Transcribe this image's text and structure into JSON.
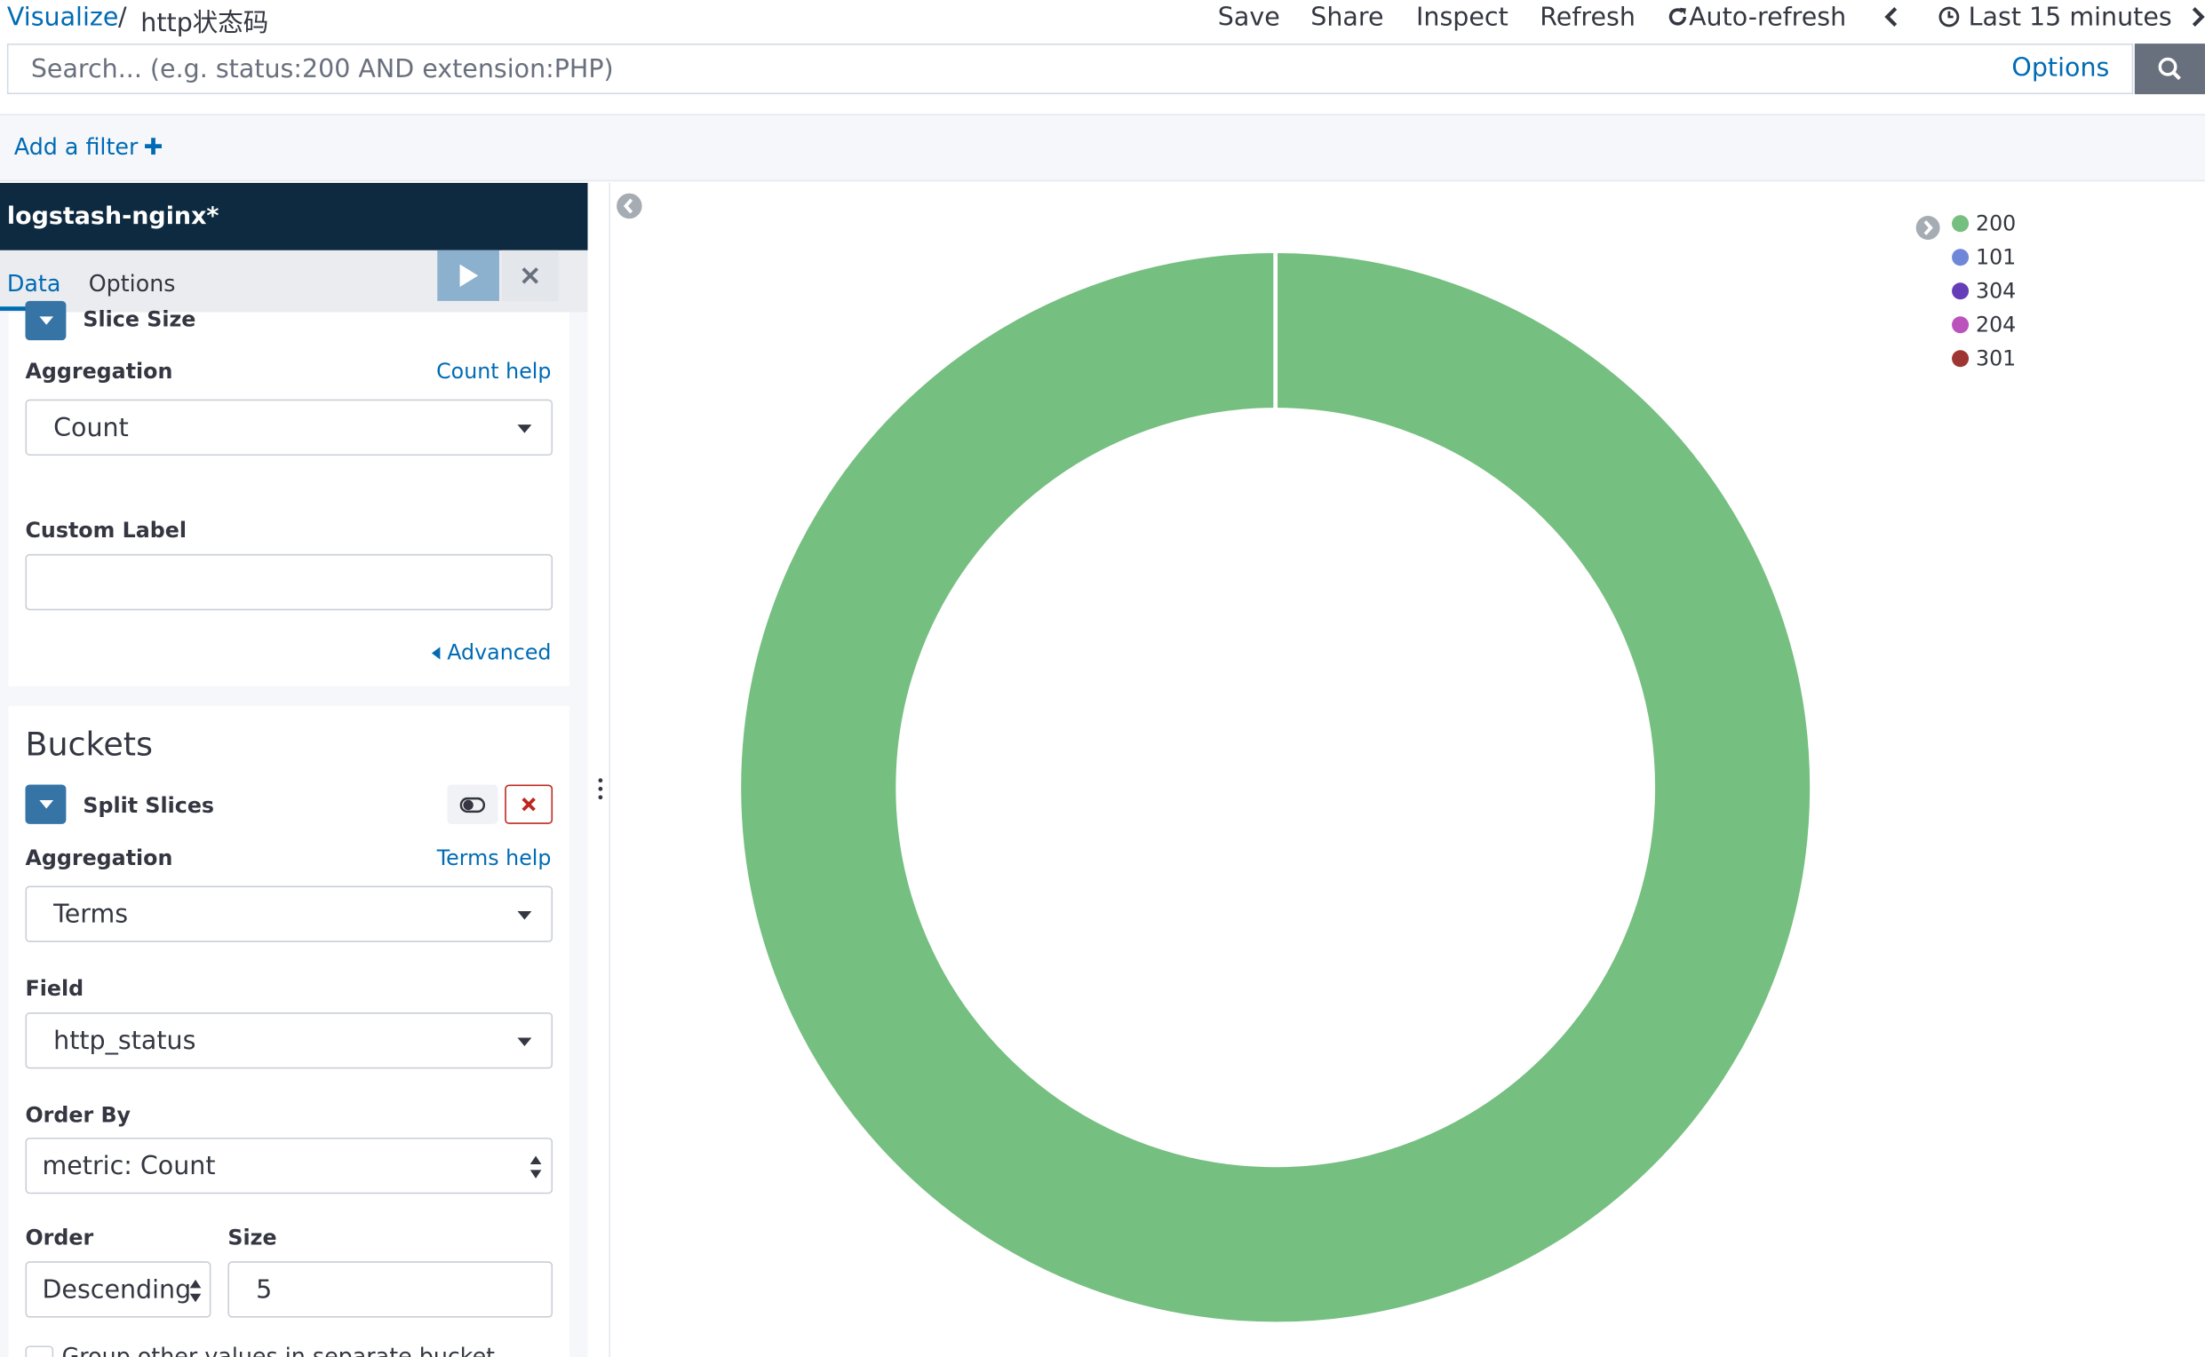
{
  "breadcrumb": {
    "parent": "Visualize",
    "separator": "/",
    "title": "http状态码"
  },
  "top_menu": {
    "save": "Save",
    "share": "Share",
    "inspect": "Inspect",
    "refresh": "Refresh",
    "auto_refresh": "Auto-refresh",
    "time_range": "Last 15 minutes"
  },
  "search": {
    "placeholder": "Search... (e.g. status:200 AND extension:PHP)",
    "options_label": "Options"
  },
  "filter": {
    "add_label": "Add a filter"
  },
  "sidebar": {
    "index_pattern": "logstash-nginx*",
    "tabs": {
      "data": "Data",
      "options": "Options"
    },
    "metrics": {
      "agg_title": "Slice Size",
      "aggregation_label": "Aggregation",
      "help": "Count help",
      "aggregation_value": "Count",
      "custom_label": "Custom Label",
      "custom_label_value": "",
      "advanced": "Advanced"
    },
    "buckets": {
      "title": "Buckets",
      "agg_title": "Split Slices",
      "aggregation_label": "Aggregation",
      "help": "Terms help",
      "aggregation_value": "Terms",
      "field_label": "Field",
      "field_value": "http_status",
      "order_by_label": "Order By",
      "order_by_value": "metric: Count",
      "order_label": "Order",
      "order_value": "Descending",
      "size_label": "Size",
      "size_value": "5",
      "checkbox_label": "Group other values in separate bucket"
    }
  },
  "chart_data": {
    "type": "pie",
    "donut": true,
    "categories": [
      "200",
      "101",
      "304",
      "204",
      "301"
    ],
    "values": [
      100,
      0,
      0,
      0,
      0
    ],
    "colors": [
      "#75bf80",
      "#6f87d8",
      "#663db8",
      "#bc52bc",
      "#9e3533"
    ],
    "legend_position": "top-right"
  }
}
